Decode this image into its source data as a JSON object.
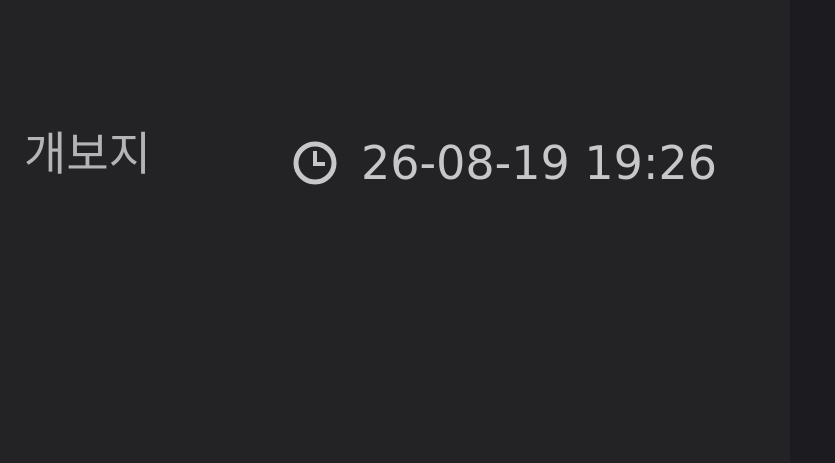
{
  "post": {
    "author": "개보지",
    "timestamp": "26-08-19 19:26",
    "icons": {
      "time": "clock-icon"
    }
  },
  "colors": {
    "background": "#232326",
    "edge": "#1c1c20",
    "author_text": "#b4b4b7",
    "time_text": "#c7c7ca"
  }
}
